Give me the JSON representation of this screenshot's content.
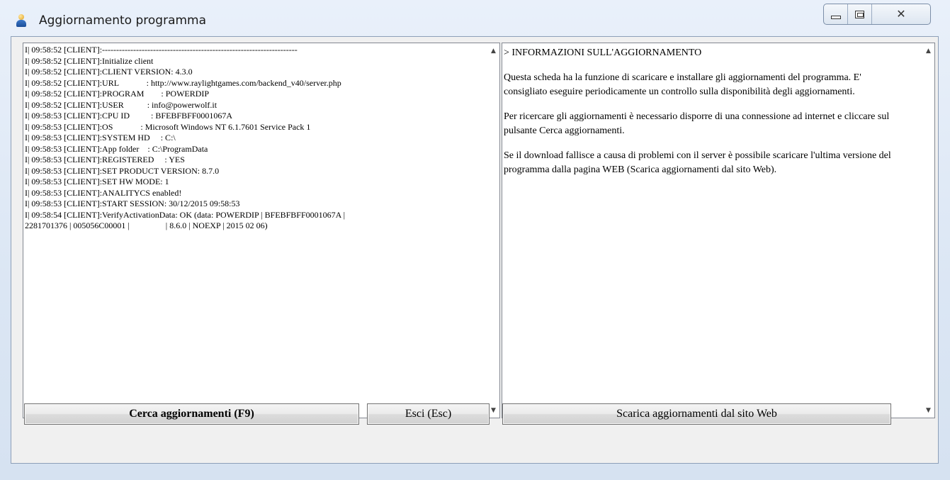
{
  "window": {
    "title": "Aggiornamento programma",
    "controls": {
      "minimize": "minimize",
      "maximize": "maximize",
      "close": "✕"
    }
  },
  "log": {
    "lines": [
      "I| 09:58:52 [CLIENT]:---------------------------------------------------------------------",
      "I| 09:58:52 [CLIENT]:Initialize client",
      "I| 09:58:52 [CLIENT]:CLIENT VERSION: 4.3.0",
      "I| 09:58:52 [CLIENT]:URL             : http://www.raylightgames.com/backend_v40/server.php",
      "I| 09:58:52 [CLIENT]:PROGRAM        : POWERDIP",
      "I| 09:58:52 [CLIENT]:USER           : info@powerwolf.it",
      "I| 09:58:53 [CLIENT]:CPU ID          : BFEBFBFF0001067A",
      "I| 09:58:53 [CLIENT]:OS             : Microsoft Windows NT 6.1.7601 Service Pack 1",
      "I| 09:58:53 [CLIENT]:SYSTEM HD     : C:\\",
      "I| 09:58:53 [CLIENT]:App folder    : C:\\ProgramData",
      "I| 09:58:53 [CLIENT]:REGISTERED     : YES",
      "I| 09:58:53 [CLIENT]:SET PRODUCT VERSION: 8.7.0",
      "I| 09:58:53 [CLIENT]:SET HW MODE: 1",
      "I| 09:58:53 [CLIENT]:ANALITYCS enabled!",
      "I| 09:58:53 [CLIENT]:START SESSION: 30/12/2015 09:58:53",
      "I| 09:58:54 [CLIENT]:VerifyActivationData: OK (data: POWERDIP | BFEBFBFF0001067A |",
      "2281701376 | 005056C00001 |                 | 8.6.0 | NOEXP | 2015 02 06)"
    ]
  },
  "info": {
    "heading": "> INFORMAZIONI SULL'AGGIORNAMENTO",
    "paragraphs": [
      "Questa scheda ha la funzione di scaricare e installare gli aggiornamenti del programma. E' consigliato eseguire periodicamente un controllo sulla disponibilità degli aggiornamenti.",
      "Per ricercare gli aggiornamenti è necessario disporre di una connessione ad internet e cliccare sul pulsante Cerca aggiornamenti.",
      "Se il download fallisce a causa di problemi con il server è possibile scaricare l'ultima versione del programma dalla pagina WEB (Scarica aggiornamenti dal sito Web)."
    ]
  },
  "scroll": {
    "up": "▲",
    "down": "▼"
  },
  "buttons": {
    "search": "Cerca aggiornamenti  (F9)",
    "exit": "Esci  (Esc)",
    "web": "Scarica aggiornamenti dal sito Web"
  }
}
